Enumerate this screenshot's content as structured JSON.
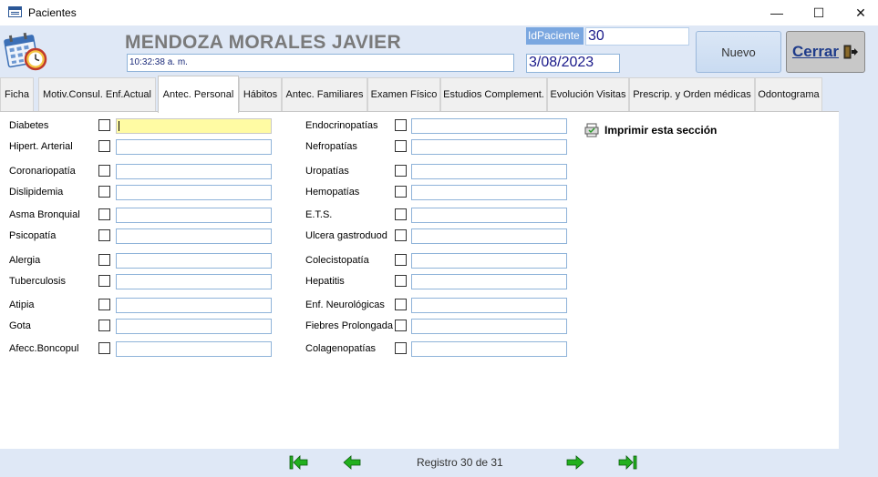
{
  "window": {
    "title": "Pacientes",
    "minimize": "—",
    "maximize": "☐",
    "close": "✕"
  },
  "header": {
    "patient_name": "MENDOZA MORALES JAVIER",
    "time": "10:32:38 a. m.",
    "id_label": "IdPaciente",
    "id_value": "30",
    "date": "3/08/2023",
    "new_button": "Nuevo",
    "close_button": "Cerrar"
  },
  "tabs": [
    {
      "label": "Ficha",
      "active": false
    },
    {
      "label": "Motiv.Consul. Enf.Actual",
      "active": false
    },
    {
      "label": "Antec. Personal",
      "active": true
    },
    {
      "label": "Hábitos",
      "active": false
    },
    {
      "label": "Antec. Familiares",
      "active": false
    },
    {
      "label": "Examen Físico",
      "active": false
    },
    {
      "label": "Estudios Complement.",
      "active": false
    },
    {
      "label": "Evolución Visitas",
      "active": false
    },
    {
      "label": "Prescrip. y Orden médicas",
      "active": false
    },
    {
      "label": "Odontograma",
      "active": false
    }
  ],
  "left_column": [
    {
      "label": "Diabetes",
      "checked": false,
      "value": ""
    },
    {
      "label": "Hipert. Arterial",
      "checked": false,
      "value": ""
    },
    {
      "label": "Coronariopatía",
      "checked": false,
      "value": ""
    },
    {
      "label": "Dislipidemia",
      "checked": false,
      "value": ""
    },
    {
      "label": "Asma Bronquial",
      "checked": false,
      "value": ""
    },
    {
      "label": "Psicopatía",
      "checked": false,
      "value": ""
    },
    {
      "label": "Alergia",
      "checked": false,
      "value": ""
    },
    {
      "label": "Tuberculosis",
      "checked": false,
      "value": ""
    },
    {
      "label": "Atipia",
      "checked": false,
      "value": ""
    },
    {
      "label": "Gota",
      "checked": false,
      "value": ""
    },
    {
      "label": "Afecc.Boncopul",
      "checked": false,
      "value": ""
    }
  ],
  "right_column": [
    {
      "label": "Endocrinopatías",
      "checked": false,
      "value": ""
    },
    {
      "label": "Nefropatías",
      "checked": false,
      "value": ""
    },
    {
      "label": "Uropatías",
      "checked": false,
      "value": ""
    },
    {
      "label": "Hemopatías",
      "checked": false,
      "value": ""
    },
    {
      "label": "E.T.S.",
      "checked": false,
      "value": ""
    },
    {
      "label": "Ulcera gastroduod",
      "checked": false,
      "value": ""
    },
    {
      "label": "Colecistopatía",
      "checked": false,
      "value": ""
    },
    {
      "label": "Hepatitis",
      "checked": false,
      "value": ""
    },
    {
      "label": "Enf. Neurológicas",
      "checked": false,
      "value": ""
    },
    {
      "label": "Fiebres Prolongada",
      "checked": false,
      "value": ""
    },
    {
      "label": "Colagenopatías",
      "checked": false,
      "value": ""
    }
  ],
  "print_section": "Imprimir esta sección",
  "footer": {
    "record": "Registro 30 de 31"
  },
  "colors": {
    "accent": "#7aa7e0",
    "header_bg": "#dfe8f6",
    "focused_field": "#fffba3",
    "nav_green": "#22b01e",
    "name_gray": "#7a7a7a"
  }
}
